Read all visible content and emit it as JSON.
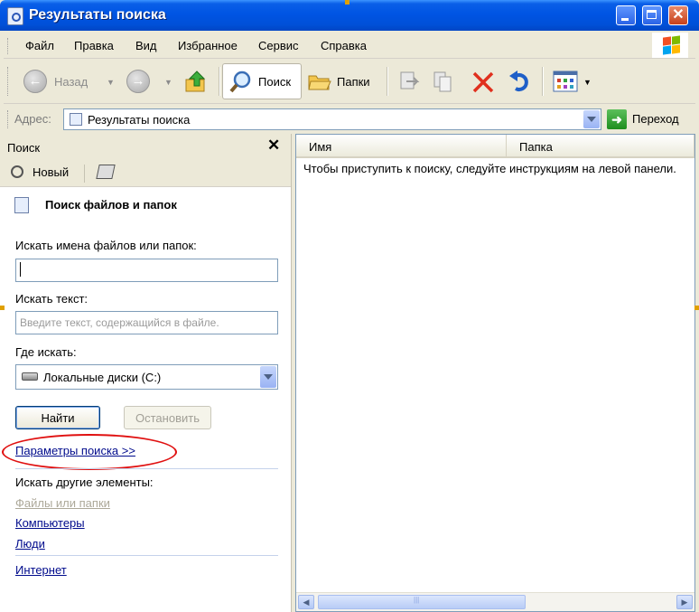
{
  "window": {
    "title": "Результаты поиска",
    "minimize_icon": "minimize-icon",
    "maximize_icon": "maximize-icon",
    "close_glyph": "✕"
  },
  "menu": {
    "items": [
      "Файл",
      "Правка",
      "Вид",
      "Избранное",
      "Сервис",
      "Справка"
    ]
  },
  "toolbar": {
    "back_label": "Назад",
    "search_label": "Поиск",
    "folders_label": "Папки"
  },
  "address": {
    "label": "Адрес:",
    "value": "Результаты поиска",
    "go_label": "Переход"
  },
  "search_pane": {
    "title": "Поиск",
    "close_glyph": "✕",
    "new_label": "Новый",
    "section_title": "Поиск файлов и папок",
    "filename_label": "Искать имена файлов или папок:",
    "filename_value": "",
    "text_label": "Искать текст:",
    "text_placeholder": "Введите текст, содержащийся в файле.",
    "location_label": "Где искать:",
    "location_value": "Локальные диски (C:)",
    "find_button": "Найти",
    "stop_button": "Остановить",
    "options_link": "Параметры поиска >>",
    "other_label": "Искать другие элементы:",
    "other_items": [
      "Файлы или папки",
      "Компьютеры",
      "Люди"
    ],
    "internet_link": "Интернет"
  },
  "results": {
    "columns": [
      "Имя",
      "Папка"
    ],
    "message": "Чтобы приступить к поиску, следуйте инструкциям на левой панели."
  },
  "colors": {
    "title_bar": "#0054e3",
    "link": "#000b8c",
    "highlight_ellipse": "#e01010"
  }
}
